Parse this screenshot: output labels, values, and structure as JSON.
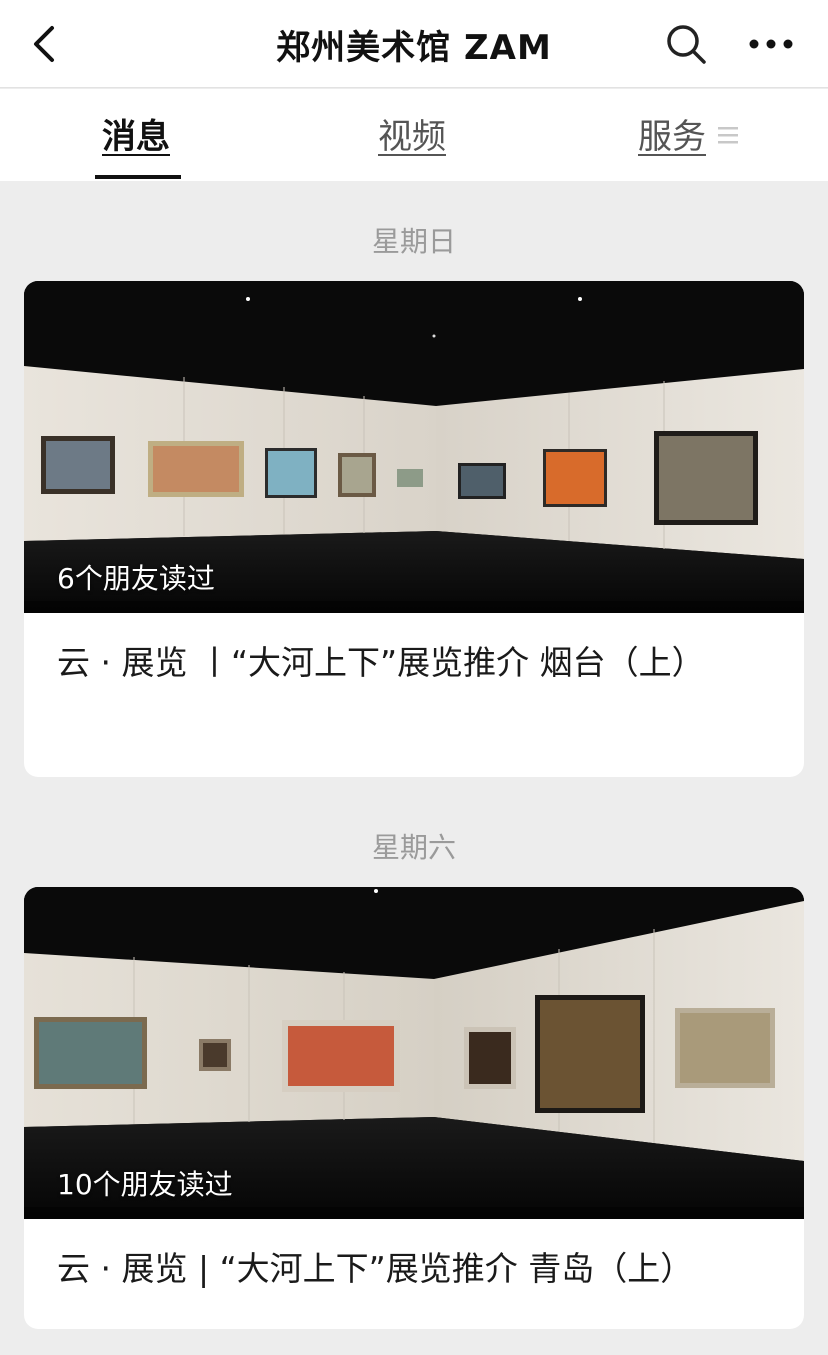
{
  "header": {
    "title": "郑州美术馆 ZAM",
    "back_icon": "chevron-left-icon",
    "search_icon": "search-icon",
    "more_icon": "more-dots-icon"
  },
  "tabs": [
    {
      "label": "消息",
      "active": true
    },
    {
      "label": "视频",
      "active": false
    },
    {
      "label": "服务",
      "active": false,
      "icon": "menu-icon"
    }
  ],
  "feed": [
    {
      "date": "星期日",
      "read_count": "6个朋友读过",
      "title": "云 · 展览 丨“大河上下”展览推介 烟台（上）"
    },
    {
      "date": "星期六",
      "read_count": "10个朋友读过",
      "title": "云 · 展览 | “大河上下”展览推介 青岛（上）"
    }
  ],
  "colors": {
    "background": "#ededed",
    "card": "#ffffff",
    "muted_text": "#9a9a9a"
  }
}
